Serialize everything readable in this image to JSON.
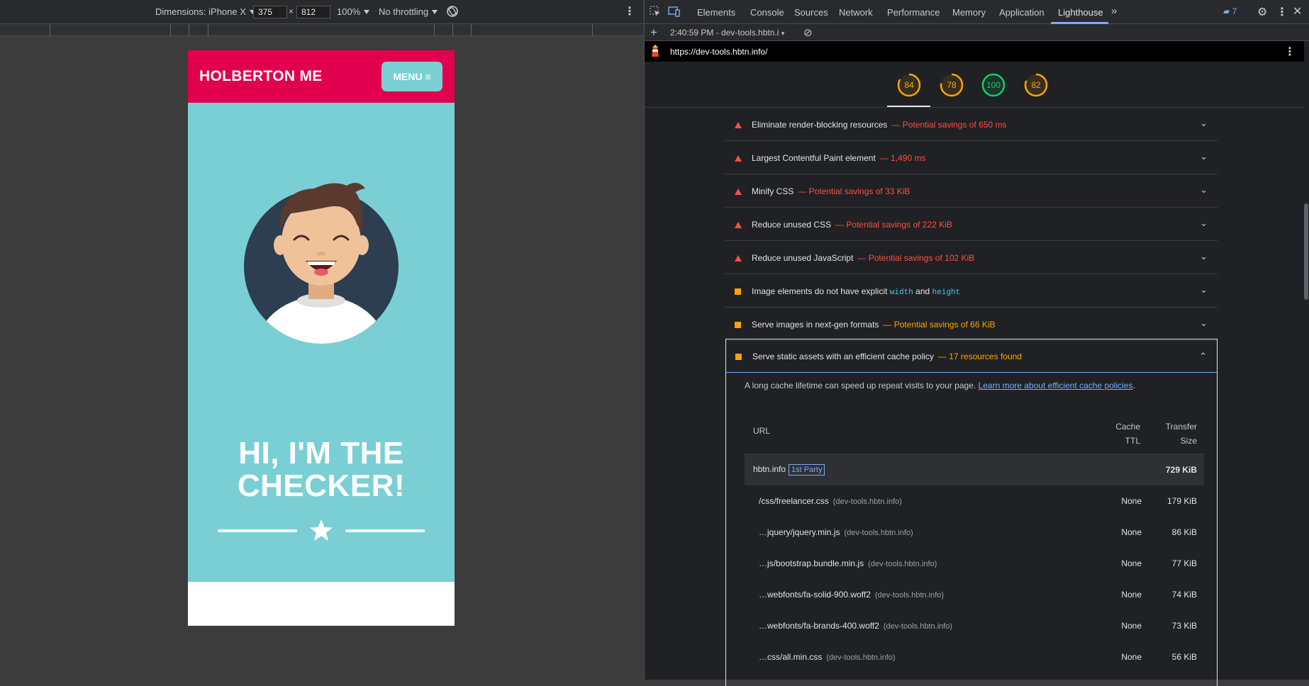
{
  "device_toolbar": {
    "dimensions_label": "Dimensions: iPhone X",
    "width": "375",
    "times": "×",
    "height": "812",
    "zoom": "100%",
    "throttling": "No throttling"
  },
  "phone": {
    "brand": "HOLBERTON ME",
    "menu_label": "MENU",
    "hero_title_line1": "HI, I'M THE",
    "hero_title_line2": "CHECKER!"
  },
  "devtools": {
    "tabs": [
      "Elements",
      "Console",
      "Sources",
      "Network",
      "Performance",
      "Memory",
      "Application",
      "Lighthouse"
    ],
    "issues_count": "7",
    "report_time": "2:40:59 PM - dev-tools.hbtn.i",
    "url": "https://dev-tools.hbtn.info/",
    "scores": [
      {
        "value": "84",
        "color": "#ffa400"
      },
      {
        "value": "78",
        "color": "#ffa400"
      },
      {
        "value": "100",
        "color": "#0cce6b"
      },
      {
        "value": "82",
        "color": "#ffa400"
      }
    ],
    "audits": [
      {
        "title": "Eliminate render-blocking resources",
        "display": "— Potential savings of 650 ms",
        "severity": "fail"
      },
      {
        "title": "Largest Contentful Paint element",
        "display": "— 1,490 ms",
        "severity": "fail"
      },
      {
        "title": "Minify CSS",
        "display": "— Potential savings of 33 KiB",
        "severity": "fail"
      },
      {
        "title": "Reduce unused CSS",
        "display": "— Potential savings of 222 KiB",
        "severity": "fail"
      },
      {
        "title": "Reduce unused JavaScript",
        "display": "— Potential savings of 102 KiB",
        "severity": "fail"
      },
      {
        "title": "Image elements do not have explicit",
        "code1": "width",
        "and": "and",
        "code2": "height",
        "severity": "average"
      },
      {
        "title": "Serve images in next-gen formats",
        "display": "— Potential savings of 66 KiB",
        "severity": "average"
      }
    ],
    "cache_audit": {
      "title": "Serve static assets with an efficient cache policy",
      "display": "— 17 resources found",
      "description": "A long cache lifetime can speed up repeat visits to your page.",
      "learn_more": "Learn more about efficient cache policies",
      "period": ".",
      "col_url": "URL",
      "col_ttl_1": "Cache",
      "col_ttl_2": "TTL",
      "col_size_1": "Transfer",
      "col_size_2": "Size",
      "party": {
        "name": "hbtn.info",
        "badge": "1st Party",
        "size": "729 KiB"
      },
      "rows": [
        {
          "url": "/css/freelancer.css",
          "host": "(dev-tools.hbtn.info)",
          "ttl": "None",
          "size": "179 KiB"
        },
        {
          "url": "…jquery/jquery.min.js",
          "host": "(dev-tools.hbtn.info)",
          "ttl": "None",
          "size": "86 KiB"
        },
        {
          "url": "…js/bootstrap.bundle.min.js",
          "host": "(dev-tools.hbtn.info)",
          "ttl": "None",
          "size": "77 KiB"
        },
        {
          "url": "…webfonts/fa-solid-900.woff2",
          "host": "(dev-tools.hbtn.info)",
          "ttl": "None",
          "size": "74 KiB"
        },
        {
          "url": "…webfonts/fa-brands-400.woff2",
          "host": "(dev-tools.hbtn.info)",
          "ttl": "None",
          "size": "73 KiB"
        },
        {
          "url": "…css/all.min.css",
          "host": "(dev-tools.hbtn.info)",
          "ttl": "None",
          "size": "56 KiB"
        }
      ]
    }
  }
}
